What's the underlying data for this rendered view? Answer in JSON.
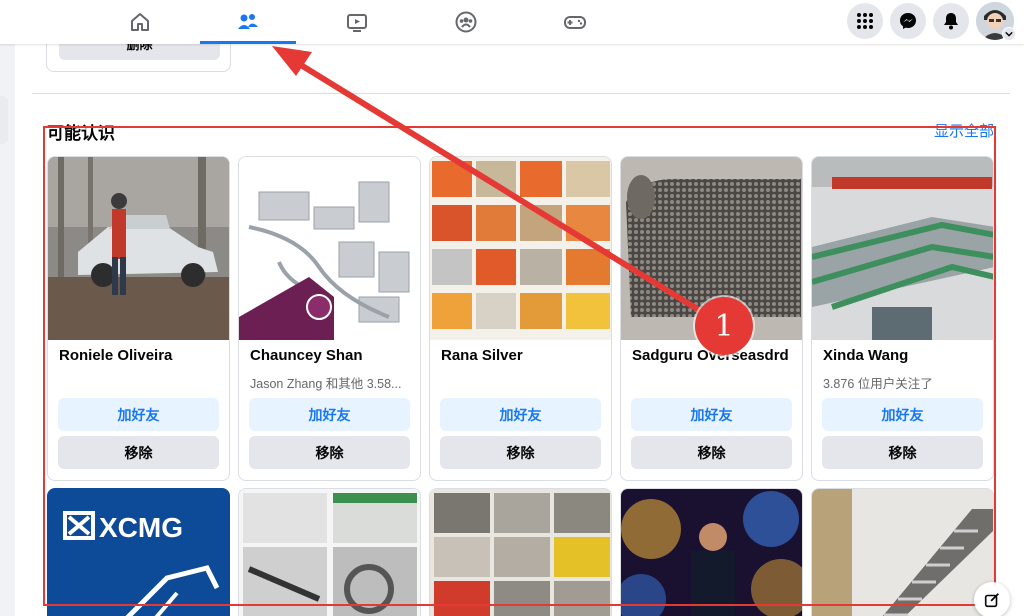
{
  "nav": {
    "tabs": [
      {
        "icon": "home-icon",
        "active": false
      },
      {
        "icon": "friends-icon",
        "active": true
      },
      {
        "icon": "watch-icon",
        "active": false
      },
      {
        "icon": "groups-icon",
        "active": false
      },
      {
        "icon": "gaming-icon",
        "active": false
      }
    ],
    "right_buttons": [
      "menu-grid-icon",
      "messenger-icon",
      "notifications-icon"
    ],
    "accent": "#1877f2"
  },
  "previous_card": {
    "remove_label": "删除"
  },
  "section": {
    "title": "可能认识",
    "see_all": "显示全部"
  },
  "suggestions": [
    {
      "name": "Roniele Oliveira",
      "subtitle": "",
      "add_label": "加好友",
      "remove_label": "移除"
    },
    {
      "name": "Chauncey Shan",
      "subtitle": "Jason Zhang 和其他 3.58...",
      "add_label": "加好友",
      "remove_label": "移除"
    },
    {
      "name": "Rana Silver",
      "subtitle": "",
      "add_label": "加好友",
      "remove_label": "移除"
    },
    {
      "name": "Sadguru Overseasdrd",
      "subtitle": "",
      "add_label": "加好友",
      "remove_label": "移除"
    },
    {
      "name": "Xinda Wang",
      "subtitle": "3.876 位用户关注了",
      "add_label": "加好友",
      "remove_label": "移除"
    }
  ],
  "second_row": [
    {
      "logo_text": "XCMG"
    },
    {},
    {},
    {},
    {}
  ],
  "annotation": {
    "callout_number": "1",
    "color": "#e53935"
  }
}
